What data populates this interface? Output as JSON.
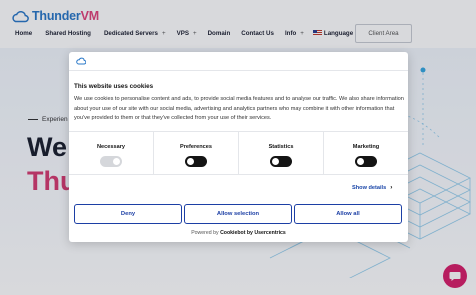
{
  "header": {
    "logo_text_a": "Thunder",
    "logo_text_b": "VM",
    "nav": [
      {
        "label": "Home",
        "has_plus": false
      },
      {
        "label": "Shared Hosting",
        "has_plus": false
      },
      {
        "label": "Dedicated Servers",
        "has_plus": true
      },
      {
        "label": "VPS",
        "has_plus": true
      },
      {
        "label": "Domain",
        "has_plus": false
      },
      {
        "label": "Contact Us",
        "has_plus": false
      },
      {
        "label": "Info",
        "has_plus": true
      },
      {
        "label": "Language",
        "has_plus": true
      }
    ],
    "client_area_label": "Client Area"
  },
  "hero": {
    "small": "Experien",
    "big1": "We",
    "big2": "Thu"
  },
  "cookie_dialog": {
    "title": "This website uses cookies",
    "body": "We use cookies to personalise content and ads, to provide social media features and to analyse our traffic. We also share information about your use of our site with our social media, advertising and analytics partners who may combine it with other information that you've provided to them or that they've collected from your use of their services.",
    "categories": [
      {
        "label": "Necessary",
        "state": "disabled"
      },
      {
        "label": "Preferences",
        "state": "off"
      },
      {
        "label": "Statistics",
        "state": "off"
      },
      {
        "label": "Marketing",
        "state": "off"
      }
    ],
    "show_details": "Show details",
    "buttons": {
      "deny": "Deny",
      "allow_selection": "Allow selection",
      "allow_all": "Allow all"
    },
    "powered_prefix": "Powered by",
    "powered_brand": "Cookiebot by Usercentrics"
  },
  "colors": {
    "brand_blue": "#2a78c8",
    "brand_pink": "#e0457b",
    "button_blue": "#1c3fa5",
    "chat_pink": "#d8206a"
  }
}
